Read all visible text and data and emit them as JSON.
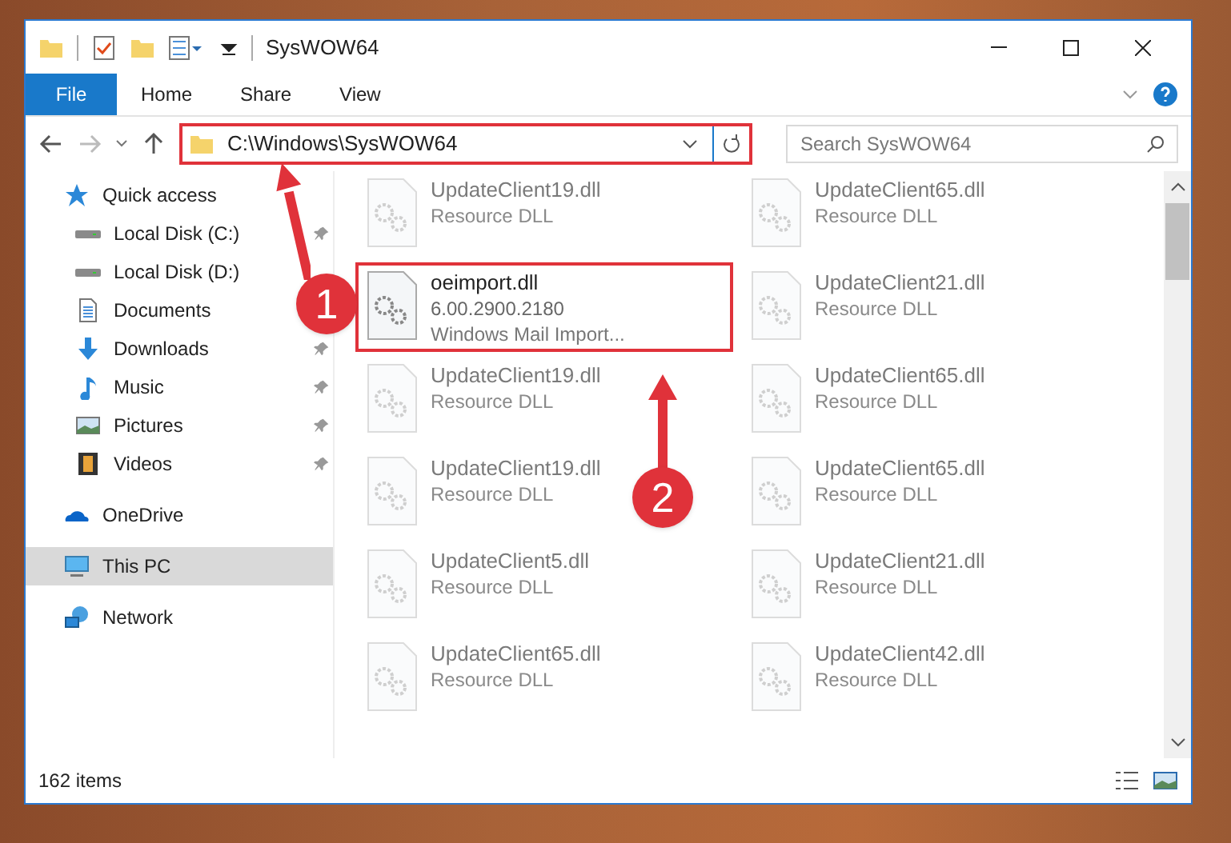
{
  "window": {
    "title": "SysWOW64"
  },
  "ribbon_tabs": [
    {
      "label": "File",
      "kind": "file"
    },
    {
      "label": "Home",
      "kind": "tab"
    },
    {
      "label": "Share",
      "kind": "tab"
    },
    {
      "label": "View",
      "kind": "tab"
    }
  ],
  "address": {
    "path": "C:\\Windows\\SysWOW64",
    "highlighted": true
  },
  "search": {
    "placeholder": "Search SysWOW64"
  },
  "sidebar": {
    "items": [
      {
        "label": "Quick access",
        "kind": "star",
        "selected": false,
        "children": [
          {
            "label": "Local Disk (C:)",
            "kind": "disk",
            "pinned": true,
            "selected": false
          },
          {
            "label": "Local Disk (D:)",
            "kind": "disk",
            "pinned": false,
            "selected": false
          },
          {
            "label": "Documents",
            "kind": "doc",
            "pinned": false,
            "selected": false
          },
          {
            "label": "Downloads",
            "kind": "download",
            "pinned": true,
            "selected": false
          },
          {
            "label": "Music",
            "kind": "music",
            "pinned": true,
            "selected": false
          },
          {
            "label": "Pictures",
            "kind": "picture",
            "pinned": true,
            "selected": false
          },
          {
            "label": "Videos",
            "kind": "video",
            "pinned": true,
            "selected": false
          }
        ]
      },
      {
        "label": "OneDrive",
        "kind": "cloud",
        "selected": false
      },
      {
        "label": "This PC",
        "kind": "pc",
        "selected": true
      },
      {
        "label": "Network",
        "kind": "network",
        "selected": false
      }
    ]
  },
  "files": [
    {
      "name": "UpdateClient19.dll",
      "line_2": "Resource DLL",
      "blurred": true,
      "highlighted": false
    },
    {
      "name": "UpdateClient65.dll",
      "line_2": "Resource DLL",
      "blurred": true,
      "highlighted": false
    },
    {
      "name": "oeimport.dll",
      "line_2": "6.00.2900.2180",
      "line_3": "Windows Mail Import...",
      "blurred": false,
      "highlighted": true
    },
    {
      "name": "UpdateClient21.dll",
      "line_2": "Resource DLL",
      "blurred": true,
      "highlighted": false
    },
    {
      "name": "UpdateClient19.dll",
      "line_2": "Resource DLL",
      "blurred": true,
      "highlighted": false
    },
    {
      "name": "UpdateClient65.dll",
      "line_2": "Resource DLL",
      "blurred": true,
      "highlighted": false
    },
    {
      "name": "UpdateClient19.dll",
      "line_2": "Resource DLL",
      "blurred": true,
      "highlighted": false
    },
    {
      "name": "UpdateClient65.dll",
      "line_2": "Resource DLL",
      "blurred": true,
      "highlighted": false
    },
    {
      "name": "UpdateClient5.dll",
      "line_2": "Resource DLL",
      "blurred": true,
      "highlighted": false
    },
    {
      "name": "UpdateClient21.dll",
      "line_2": "Resource DLL",
      "blurred": true,
      "highlighted": false
    },
    {
      "name": "UpdateClient65.dll",
      "line_2": "Resource DLL",
      "blurred": true,
      "highlighted": false
    },
    {
      "name": "UpdateClient42.dll",
      "line_2": "Resource DLL",
      "blurred": true,
      "highlighted": false
    }
  ],
  "status_bar": {
    "item_count": "162 items"
  },
  "annotations": [
    {
      "label": "1"
    },
    {
      "label": "2"
    }
  ]
}
